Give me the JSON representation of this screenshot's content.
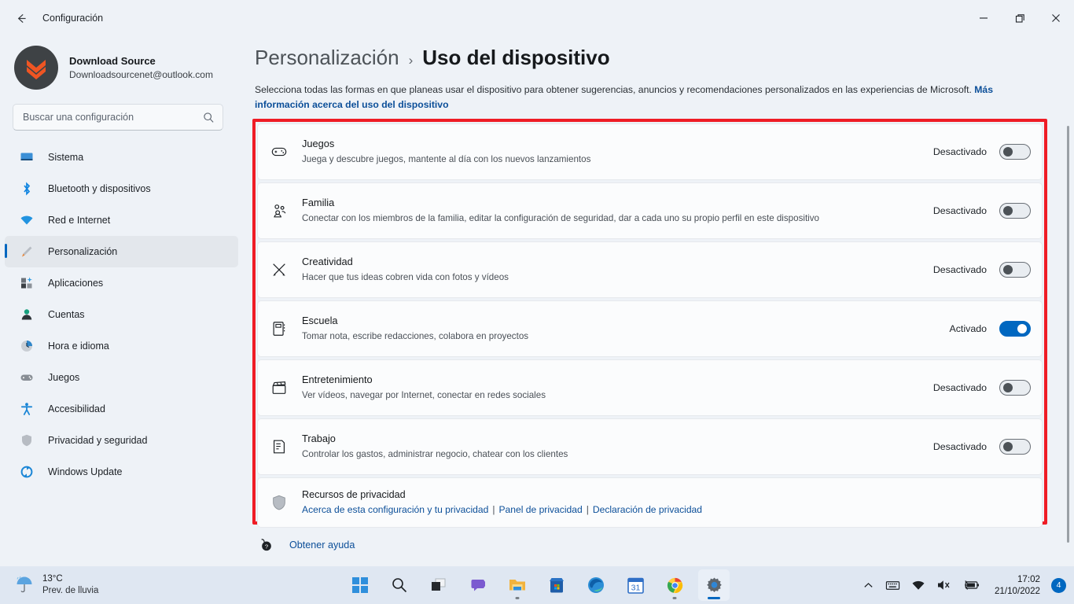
{
  "window": {
    "title": "Configuración",
    "back_icon": "arrow-left-icon",
    "minimize_label": "—",
    "maximize_label": "❐",
    "close_label": "✕"
  },
  "account": {
    "name": "Download Source",
    "email": "Downloadsourcenet@outlook.com",
    "avatar_icon": "download-chevrons-avatar"
  },
  "search": {
    "placeholder": "Buscar una configuración",
    "icon": "search-icon"
  },
  "sidebar": {
    "items": [
      {
        "label": "Sistema",
        "icon": "monitor-icon",
        "active": false
      },
      {
        "label": "Bluetooth y dispositivos",
        "icon": "bluetooth-icon",
        "active": false
      },
      {
        "label": "Red e Internet",
        "icon": "wifi-icon",
        "active": false
      },
      {
        "label": "Personalización",
        "icon": "paintbrush-icon",
        "active": true
      },
      {
        "label": "Aplicaciones",
        "icon": "apps-icon",
        "active": false
      },
      {
        "label": "Cuentas",
        "icon": "person-icon",
        "active": false
      },
      {
        "label": "Hora e idioma",
        "icon": "clock-icon",
        "active": false
      },
      {
        "label": "Juegos",
        "icon": "gamepad-icon",
        "active": false
      },
      {
        "label": "Accesibilidad",
        "icon": "accessibility-icon",
        "active": false
      },
      {
        "label": "Privacidad y seguridad",
        "icon": "shield-icon",
        "active": false
      },
      {
        "label": "Windows Update",
        "icon": "update-icon",
        "active": false
      }
    ]
  },
  "breadcrumb": {
    "parent": "Personalización",
    "separator": "›",
    "current": "Uso del dispositivo"
  },
  "intro": {
    "text": "Selecciona todas las formas en que planeas usar el dispositivo para obtener sugerencias, anuncios y recomendaciones personalizados en las experiencias de Microsoft. ",
    "link": "Más información acerca del uso del dispositivo"
  },
  "accent_color": "#0067c0",
  "annotation_color": "#ef1c25",
  "rows": [
    {
      "title": "Juegos",
      "desc": "Juega y descubre juegos, mantente al día con los nuevos lanzamientos",
      "icon": "gamepad-icon",
      "state_label": "Desactivado",
      "on": false
    },
    {
      "title": "Familia",
      "desc": "Conectar con los miembros de la familia, editar la configuración de seguridad, dar a cada uno su propio perfil en este dispositivo",
      "icon": "people-icon",
      "state_label": "Desactivado",
      "on": false
    },
    {
      "title": "Creatividad",
      "desc": "Hacer que tus ideas cobren vida con fotos y vídeos",
      "icon": "brush-pencil-icon",
      "state_label": "Desactivado",
      "on": false
    },
    {
      "title": "Escuela",
      "desc": "Tomar nota, escribe redacciones, colabora en proyectos",
      "icon": "notebook-icon",
      "state_label": "Activado",
      "on": true
    },
    {
      "title": "Entretenimiento",
      "desc": "Ver vídeos, navegar por Internet, conectar en redes sociales",
      "icon": "clapperboard-icon",
      "state_label": "Desactivado",
      "on": false
    },
    {
      "title": "Trabajo",
      "desc": "Controlar los gastos, administrar negocio, chatear con los clientes",
      "icon": "document-icon",
      "state_label": "Desactivado",
      "on": false
    }
  ],
  "privacy": {
    "title": "Recursos de privacidad",
    "icon": "shield-icon",
    "links": [
      "Acerca de esta configuración y tu privacidad",
      "Panel de privacidad",
      "Declaración de privacidad"
    ],
    "separator": "|"
  },
  "help": {
    "label": "Obtener ayuda",
    "icon": "help-question-icon"
  },
  "taskbar": {
    "weather": {
      "temperature": "13°C",
      "condition": "Prev. de lluvia",
      "icon": "rain-umbrella-icon"
    },
    "icons": [
      {
        "name": "start-icon",
        "active": false,
        "running": false
      },
      {
        "name": "search-icon",
        "active": false,
        "running": false
      },
      {
        "name": "task-view-icon",
        "active": false,
        "running": false
      },
      {
        "name": "chat-icon",
        "active": false,
        "running": false
      },
      {
        "name": "file-explorer-icon",
        "active": false,
        "running": true
      },
      {
        "name": "microsoft-store-icon",
        "active": false,
        "running": false
      },
      {
        "name": "edge-icon",
        "active": false,
        "running": false
      },
      {
        "name": "calendar-icon",
        "active": false,
        "running": false
      },
      {
        "name": "chrome-icon",
        "active": false,
        "running": true
      },
      {
        "name": "settings-icon",
        "active": true,
        "running": true
      }
    ],
    "calendar_day": "31",
    "tray": {
      "chevron": "chevron-up-icon",
      "keyboard": "keyboard-icon",
      "wifi": "wifi-icon",
      "volume": "speaker-muted-icon",
      "battery": "battery-charging-icon",
      "time": "17:02",
      "date": "21/10/2022",
      "notification_count": "4"
    }
  }
}
